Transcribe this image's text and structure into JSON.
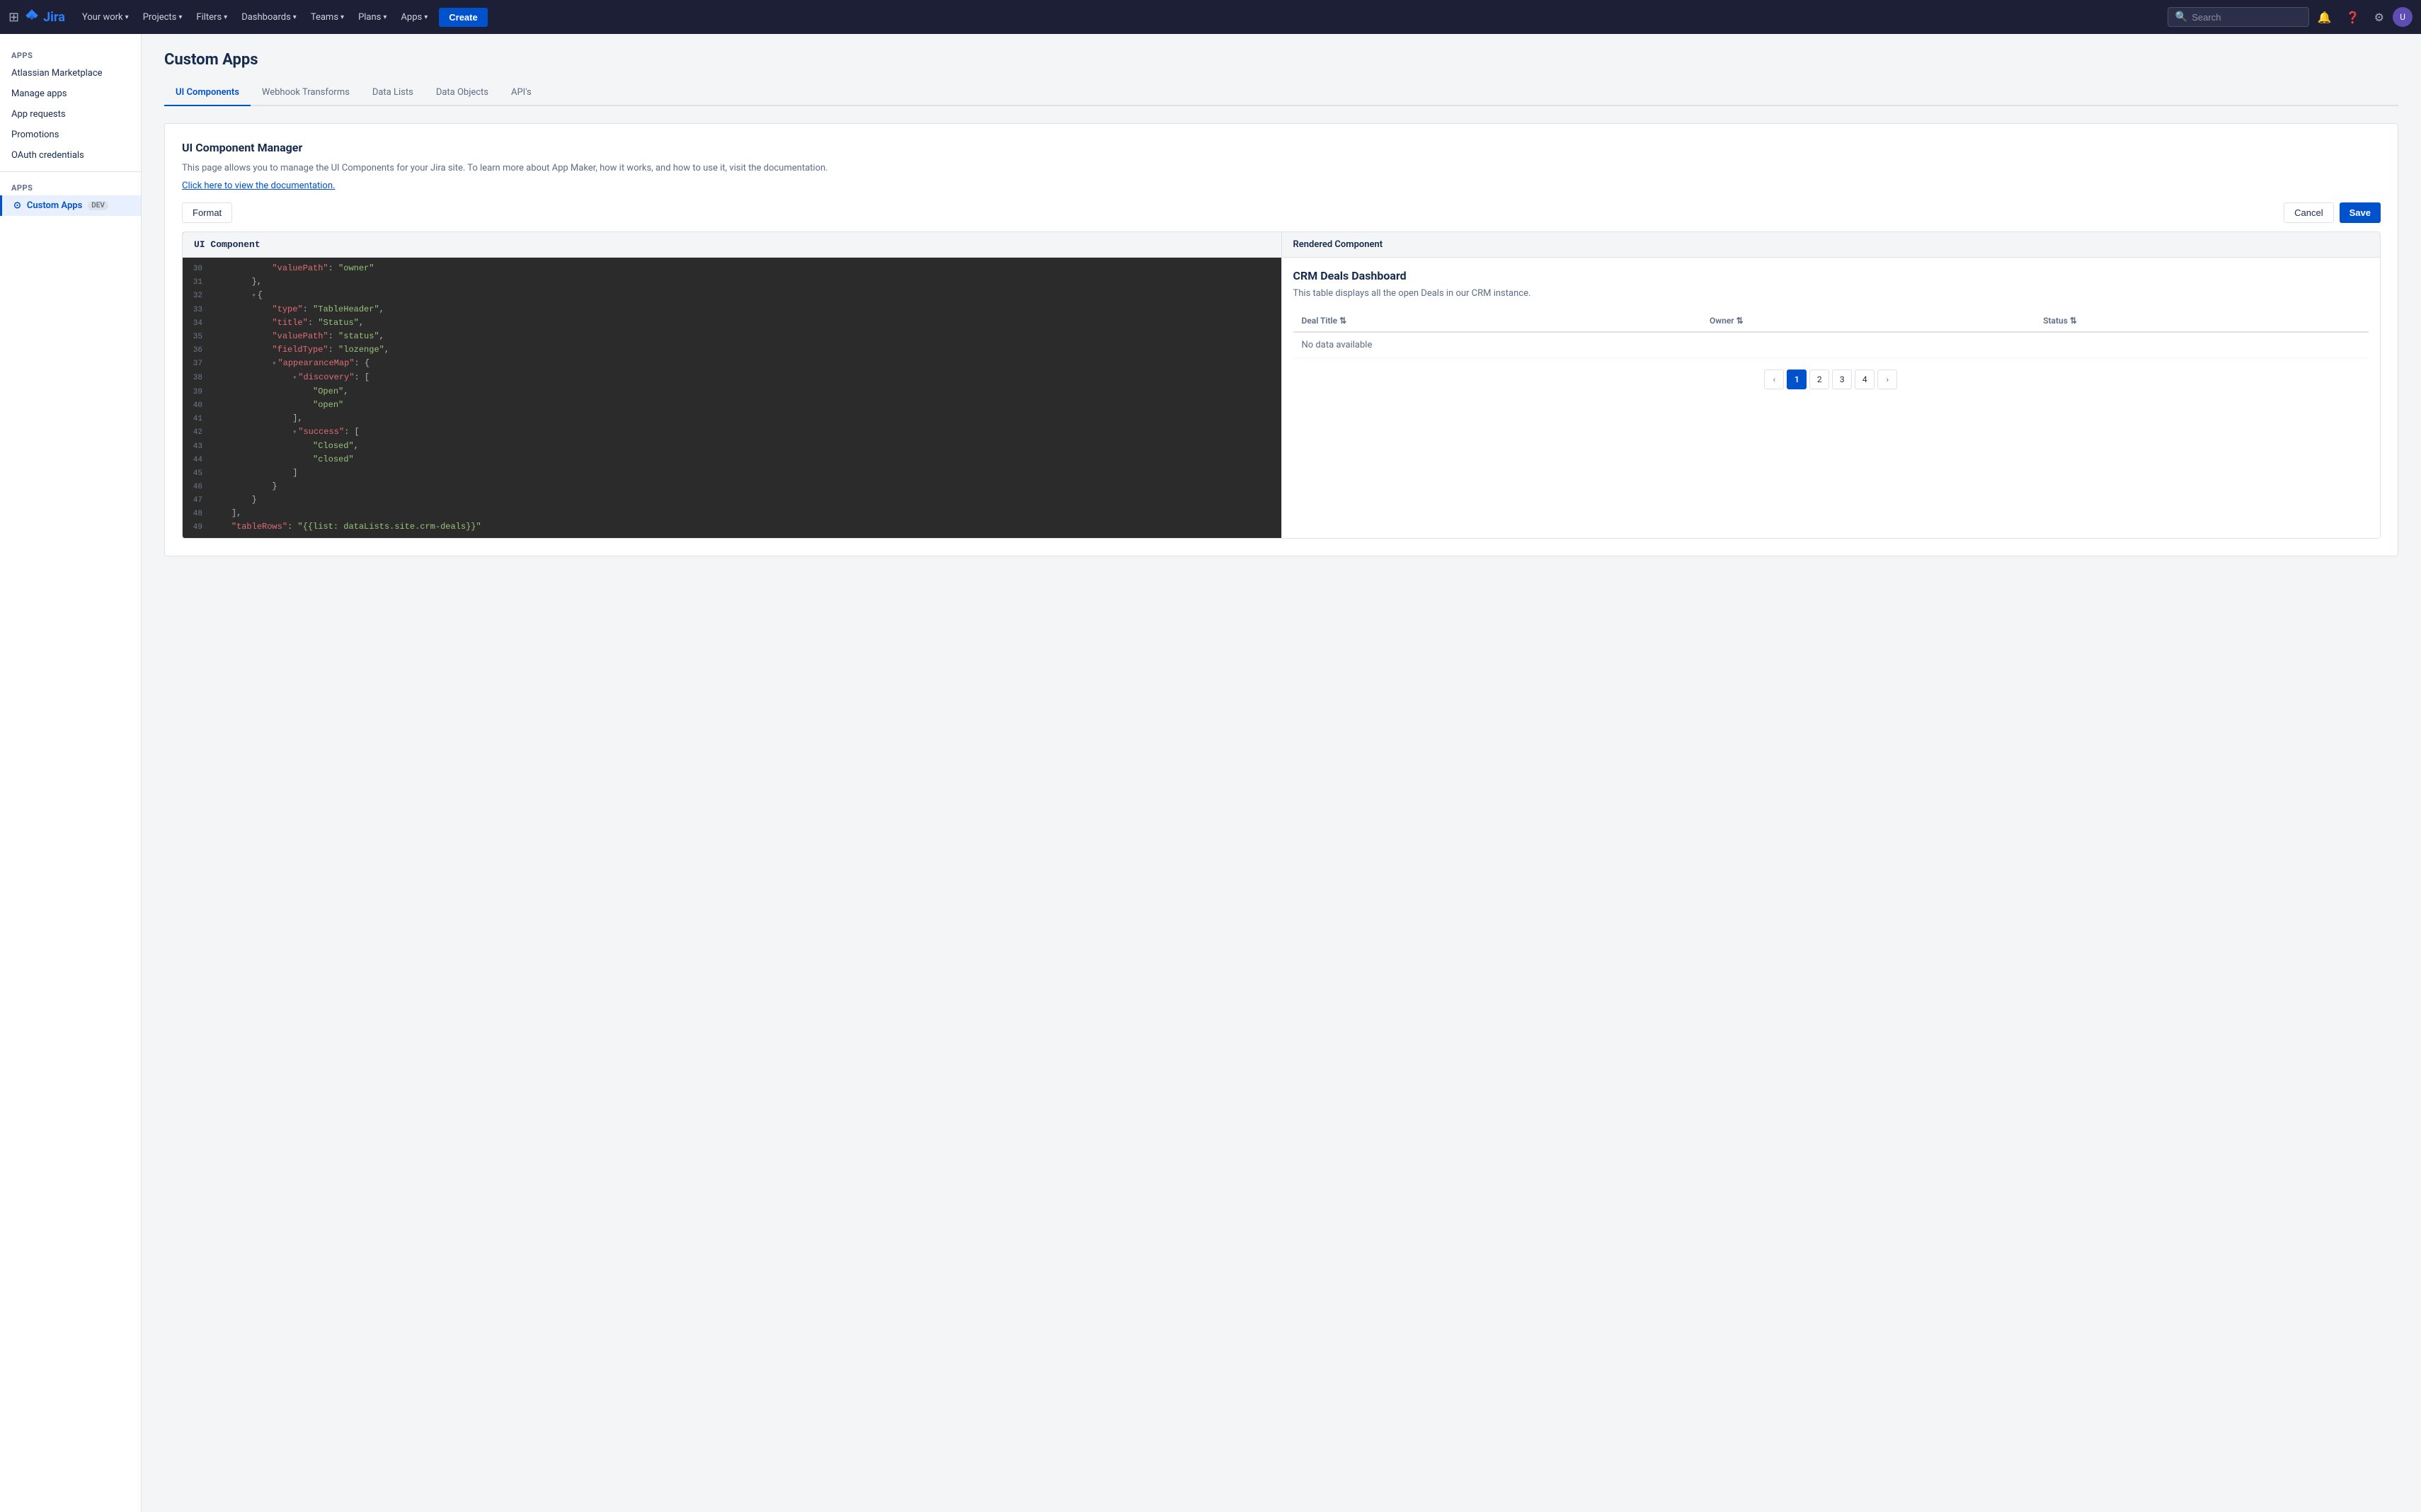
{
  "topnav": {
    "logo_text": "Jira",
    "items": [
      {
        "label": "Your work",
        "id": "your-work"
      },
      {
        "label": "Projects",
        "id": "projects"
      },
      {
        "label": "Filters",
        "id": "filters"
      },
      {
        "label": "Dashboards",
        "id": "dashboards"
      },
      {
        "label": "Teams",
        "id": "teams"
      },
      {
        "label": "Plans",
        "id": "plans"
      },
      {
        "label": "Apps",
        "id": "apps"
      }
    ],
    "create_label": "Create",
    "search_placeholder": "Search"
  },
  "sidebar": {
    "apps_title": "Apps",
    "items": [
      {
        "label": "Atlassian Marketplace",
        "id": "marketplace"
      },
      {
        "label": "Manage apps",
        "id": "manage-apps"
      },
      {
        "label": "App requests",
        "id": "app-requests"
      },
      {
        "label": "Promotions",
        "id": "promotions"
      },
      {
        "label": "OAuth credentials",
        "id": "oauth"
      }
    ],
    "apps_section_title": "Apps",
    "custom_apps_label": "Custom Apps",
    "custom_apps_badge": "DEV"
  },
  "page": {
    "title": "Custom Apps",
    "tabs": [
      {
        "label": "UI Components",
        "id": "ui-components",
        "active": true
      },
      {
        "label": "Webhook Transforms",
        "id": "webhook-transforms"
      },
      {
        "label": "Data Lists",
        "id": "data-lists"
      },
      {
        "label": "Data Objects",
        "id": "data-objects"
      },
      {
        "label": "API's",
        "id": "apis"
      }
    ],
    "section_title": "UI Component Manager",
    "section_desc": "This page allows you to manage the UI Components for your Jira site. To learn more about App Maker, how it works, and how to use it, visit the documentation.",
    "doc_link": "Click here to view the documentation.",
    "toolbar": {
      "format_label": "Format",
      "cancel_label": "Cancel",
      "save_label": "Save"
    },
    "editor": {
      "header": "UI Component",
      "lines": [
        {
          "num": "30",
          "content": "            \"valuePath\": \"owner\"",
          "indent": 12
        },
        {
          "num": "31",
          "content": "        },",
          "indent": 8
        },
        {
          "num": "32",
          "content": "        {",
          "indent": 8,
          "collapsible": true
        },
        {
          "num": "33",
          "content": "            \"type\": \"TableHeader\",",
          "indent": 12
        },
        {
          "num": "34",
          "content": "            \"title\": \"Status\",",
          "indent": 12
        },
        {
          "num": "35",
          "content": "            \"valuePath\": \"status\",",
          "indent": 12
        },
        {
          "num": "36",
          "content": "            \"fieldType\": \"lozenge\",",
          "indent": 12
        },
        {
          "num": "37",
          "content": "            \"appearanceMap\": {",
          "indent": 12,
          "collapsible": true
        },
        {
          "num": "38",
          "content": "                \"discovery\": [",
          "indent": 16,
          "collapsible": true
        },
        {
          "num": "39",
          "content": "                    \"Open\",",
          "indent": 20
        },
        {
          "num": "40",
          "content": "                    \"open\"",
          "indent": 20
        },
        {
          "num": "41",
          "content": "                ],",
          "indent": 16
        },
        {
          "num": "42",
          "content": "                \"success\": [",
          "indent": 16,
          "collapsible": true
        },
        {
          "num": "43",
          "content": "                    \"Closed\",",
          "indent": 20
        },
        {
          "num": "44",
          "content": "                    \"closed\"",
          "indent": 20
        },
        {
          "num": "45",
          "content": "                ]",
          "indent": 16
        },
        {
          "num": "46",
          "content": "            }",
          "indent": 12
        },
        {
          "num": "47",
          "content": "        }",
          "indent": 8
        },
        {
          "num": "48",
          "content": "    ],",
          "indent": 4
        },
        {
          "num": "49",
          "content": "    \"tableRows\": \"{{list: dataLists.site.crm-deals}}\"",
          "indent": 4
        }
      ]
    },
    "rendered": {
      "header": "Rendered Component",
      "title": "CRM Deals Dashboard",
      "desc": "This table displays all the open Deals in our CRM instance.",
      "table": {
        "columns": [
          {
            "label": "Deal Title",
            "sortable": true
          },
          {
            "label": "Owner",
            "sortable": true
          },
          {
            "label": "Status",
            "sortable": true
          }
        ],
        "no_data_text": "No data available"
      },
      "pagination": {
        "pages": [
          "1",
          "2",
          "3",
          "4"
        ],
        "active": "1"
      }
    }
  }
}
